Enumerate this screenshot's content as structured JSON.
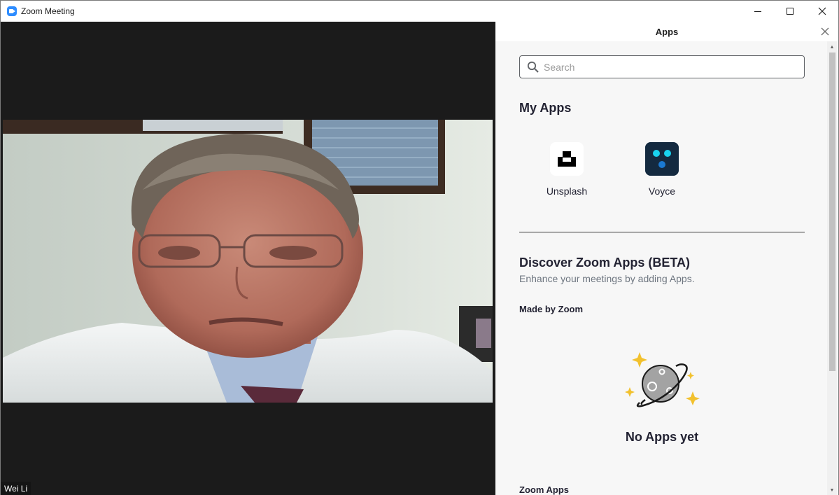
{
  "window": {
    "title": "Zoom Meeting"
  },
  "video": {
    "participant_name": "Wei Li"
  },
  "apps_panel": {
    "title": "Apps",
    "search": {
      "placeholder": "Search",
      "value": ""
    },
    "my_apps": {
      "heading": "My Apps",
      "items": [
        {
          "label": "Unsplash",
          "icon": "unsplash-icon"
        },
        {
          "label": "Voyce",
          "icon": "voyce-icon"
        }
      ]
    },
    "discover": {
      "heading": "Discover Zoom Apps (BETA)",
      "subtitle": "Enhance your meetings by adding Apps.",
      "made_by": "Made by Zoom",
      "empty_text": "No Apps yet",
      "next_section": "Zoom Apps"
    }
  },
  "colors": {
    "accent": "#2d8cff",
    "video_bg": "#1b1b1b",
    "panel_bg": "#f7f7f7",
    "sparkle": "#f2c12e"
  }
}
